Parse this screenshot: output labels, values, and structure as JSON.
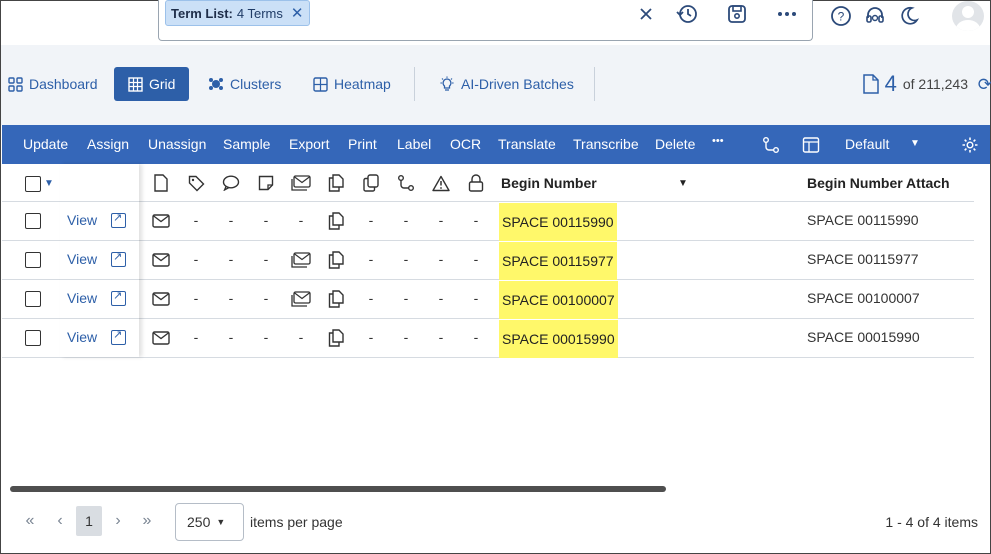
{
  "search": {
    "chip_label": "Term List:",
    "chip_value": "4 Terms"
  },
  "nav": {
    "items": [
      {
        "label": "Dashboard"
      },
      {
        "label": "Grid"
      },
      {
        "label": "Clusters"
      },
      {
        "label": "Heatmap"
      },
      {
        "label": "AI-Driven Batches"
      }
    ],
    "doc_current": "4",
    "doc_total": "of 211,243"
  },
  "toolbar": {
    "actions": [
      "Update",
      "Assign",
      "Unassign",
      "Sample",
      "Export",
      "Print",
      "Label",
      "OCR",
      "Translate",
      "Transcribe",
      "Delete"
    ],
    "more": "•••",
    "layout_name": "Default"
  },
  "grid": {
    "columns": {
      "begin_number": "Begin Number",
      "begin_number_attach": "Begin Number Attach"
    },
    "view_label": "View",
    "dash": "-",
    "rows": [
      {
        "begin_number": "SPACE 00115990",
        "attach": "SPACE 00115990",
        "has_thread": false
      },
      {
        "begin_number": "SPACE 00115977",
        "attach": "SPACE 00115977",
        "has_thread": true
      },
      {
        "begin_number": "SPACE 00100007",
        "attach": "SPACE 00100007",
        "has_thread": true
      },
      {
        "begin_number": "SPACE 00015990",
        "attach": "SPACE 00015990",
        "has_thread": false
      }
    ]
  },
  "pager": {
    "current_page": "1",
    "page_size": "250",
    "page_size_label": "items per page",
    "range": "1 - 4 of 4 items"
  },
  "colors": {
    "primary": "#3567b9",
    "link": "#2d5fa8",
    "highlight": "#fff86a",
    "nav_bg": "#f1f4f8"
  }
}
